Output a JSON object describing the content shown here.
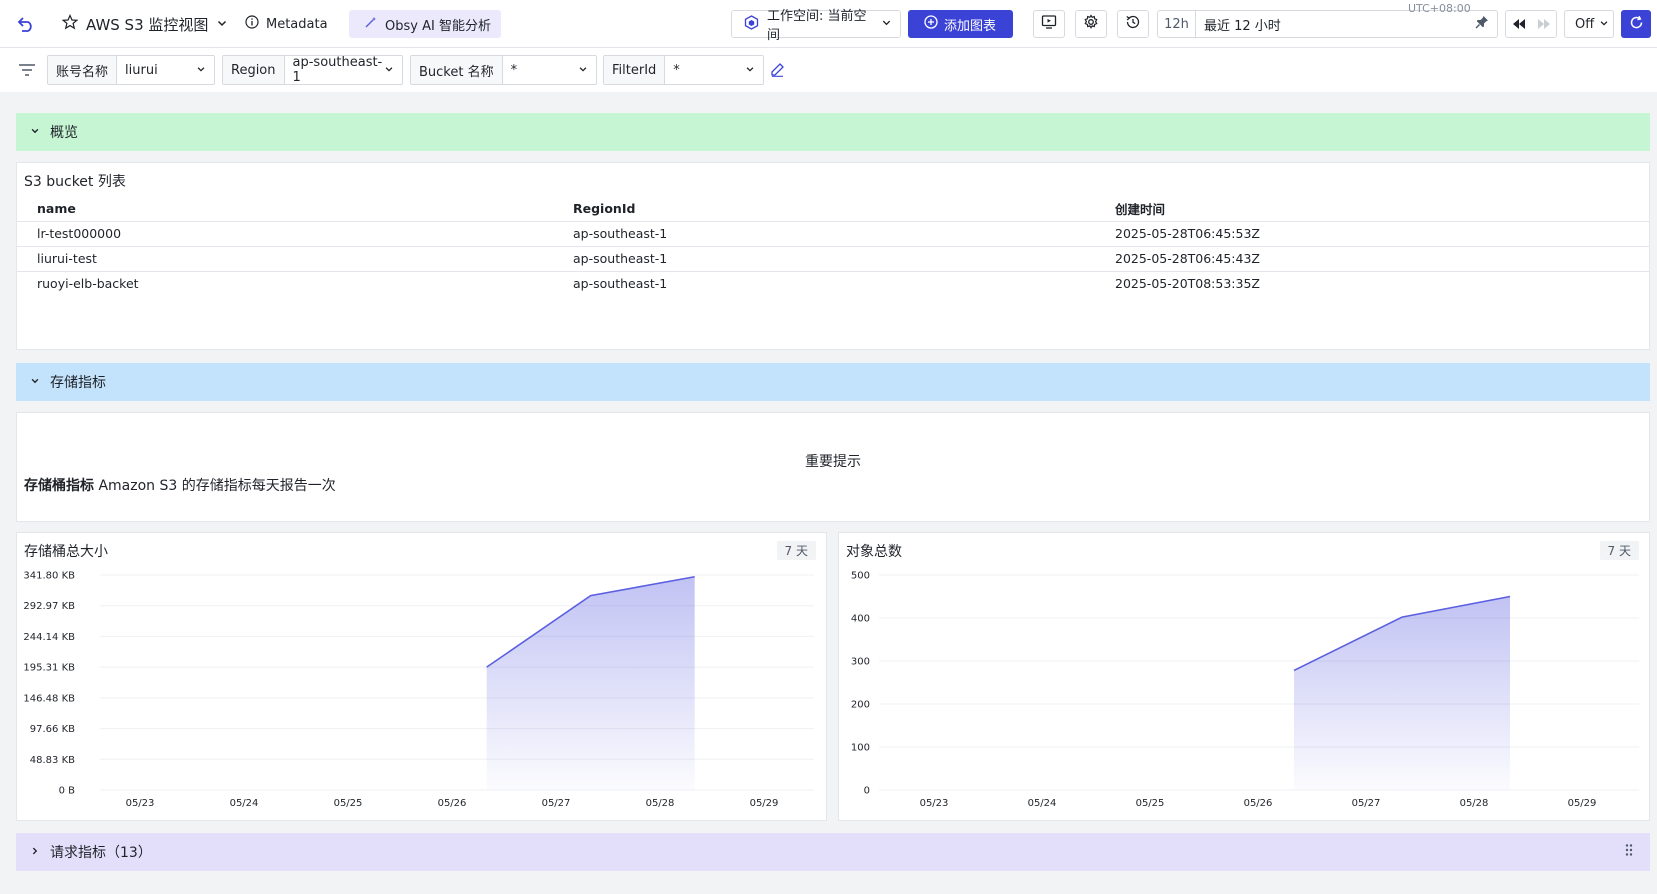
{
  "toolbar": {
    "title": "AWS S3 监控视图",
    "metadata_label": "Metadata",
    "ai_label": "Obsy AI 智能分析",
    "workspace_label": "工作空间: 当前空间",
    "add_chart_label": "添加图表",
    "time_quick": "12h",
    "time_label": "最近 12 小时",
    "timezone": "UTC+08:00",
    "refresh_interval": "Off"
  },
  "filters": [
    {
      "key": "账号名称",
      "value": "liurui"
    },
    {
      "key": "Region",
      "value": "ap-southeast-1"
    },
    {
      "key": "Bucket 名称",
      "value": "*"
    },
    {
      "key": "FilterId",
      "value": "*"
    }
  ],
  "rows": {
    "overview": "概览",
    "storage": "存储指标",
    "request": "请求指标（13）"
  },
  "table_panel": {
    "title": "S3 bucket 列表",
    "columns": [
      "name",
      "RegionId",
      "创建时间"
    ],
    "rows": [
      [
        "lr-test000000",
        "ap-southeast-1",
        "2025-05-28T06:45:53Z"
      ],
      [
        "liurui-test",
        "ap-southeast-1",
        "2025-05-28T06:45:43Z"
      ],
      [
        "ruoyi-elb-backet",
        "ap-southeast-1",
        "2025-05-20T08:53:35Z"
      ]
    ]
  },
  "note_panel": {
    "heading": "重要提示",
    "bold": "存储桶指标",
    "text": " Amazon S3 的存储指标每天报告一次"
  },
  "colors": {
    "accent": "#3b42d6",
    "line": "#5b5fe0",
    "overview_row": "#c5f5d3",
    "storage_row": "#c3e2fb",
    "request_row": "#e3dffb"
  },
  "chart_data": [
    {
      "type": "area",
      "title": "存储桶总大小",
      "badge": "7 天",
      "x_ticks": [
        "05/23",
        "05/24",
        "05/25",
        "05/26",
        "05/27",
        "05/28",
        "05/29"
      ],
      "y_ticks": [
        "0 B",
        "48.83 KB",
        "97.66 KB",
        "146.48 KB",
        "195.31 KB",
        "244.14 KB",
        "292.97 KB",
        "341.80 KB"
      ],
      "ylim": [
        0,
        341.8
      ],
      "series": [
        {
          "x": [
            "05/26 08:00",
            "05/27 08:00",
            "05/28 08:00"
          ],
          "y": [
            195.3,
            309,
            339
          ]
        }
      ]
    },
    {
      "type": "area",
      "title": "对象总数",
      "badge": "7 天",
      "x_ticks": [
        "05/23",
        "05/24",
        "05/25",
        "05/26",
        "05/27",
        "05/28",
        "05/29"
      ],
      "y_ticks": [
        "0",
        "100",
        "200",
        "300",
        "400",
        "500"
      ],
      "ylim": [
        0,
        500
      ],
      "series": [
        {
          "x": [
            "05/26 08:00",
            "05/27 08:00",
            "05/28 08:00"
          ],
          "y": [
            278,
            402,
            450
          ]
        }
      ]
    }
  ]
}
